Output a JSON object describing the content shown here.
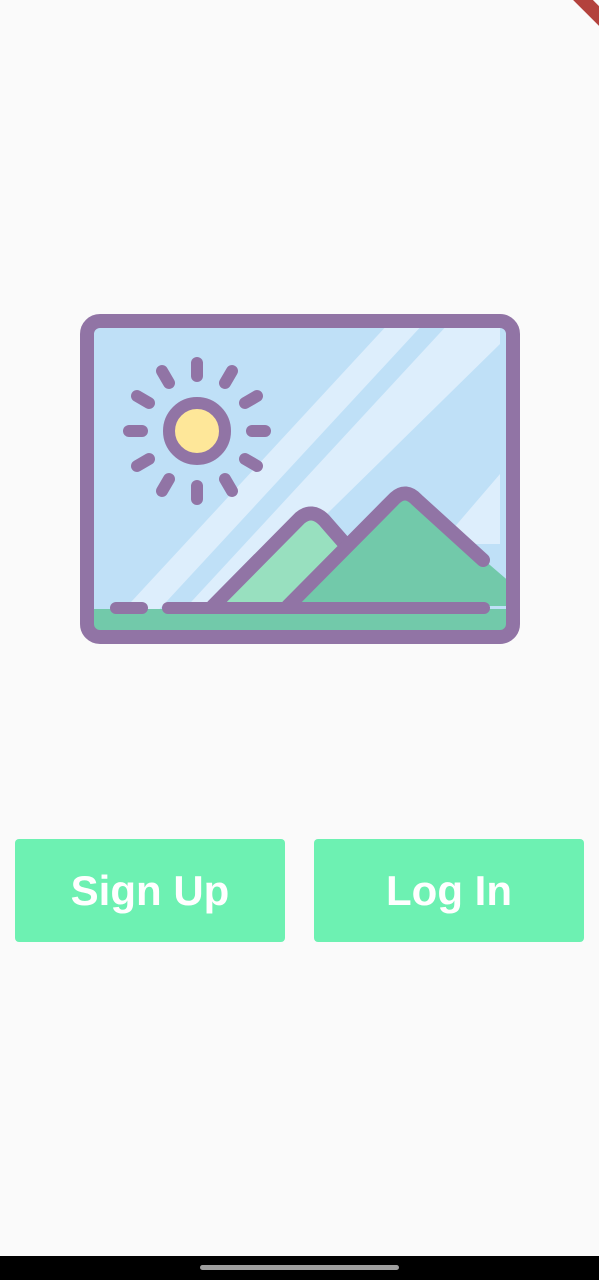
{
  "app": {
    "illustration_icon": "image-placeholder-icon",
    "debug_banner_icon": "debug-ribbon"
  },
  "buttons": {
    "signup_label": "Sign Up",
    "login_label": "Log In"
  },
  "colors": {
    "button": "#6df1b2",
    "frame": "#9174a5",
    "sky": "#bfe0f7",
    "sun": "#fee799",
    "mountain": "#72c9aa"
  }
}
